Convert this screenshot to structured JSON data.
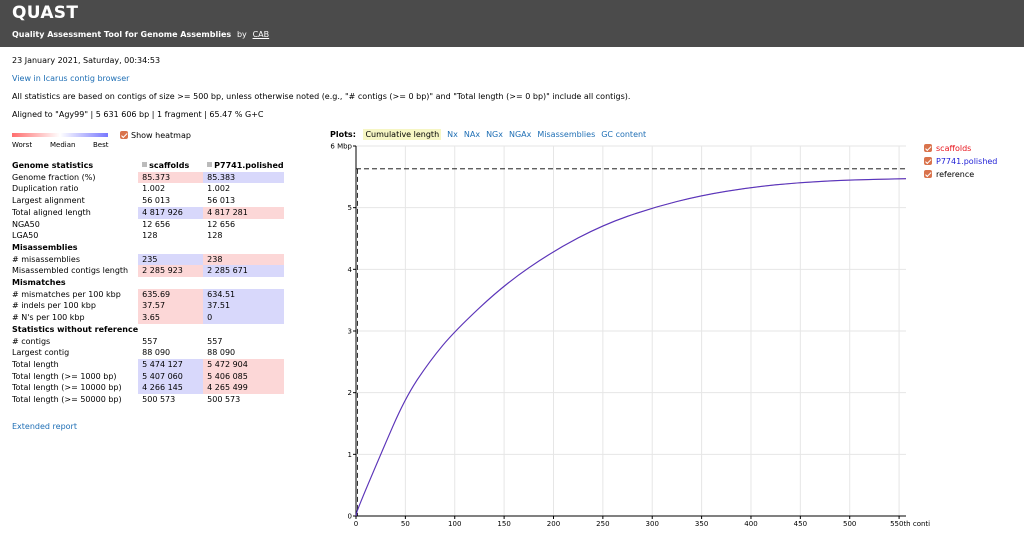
{
  "header": {
    "brand": "QUAST",
    "subtitle": "Quality Assessment Tool for Genome Assemblies",
    "by": "by",
    "by_link": "CAB"
  },
  "report": {
    "date": "23 January 2021, Saturday, 00:34:53",
    "icarus_link": "View in Icarus contig browser",
    "note": "All statistics are based on contigs of size >= 500 bp, unless otherwise noted (e.g., \"# contigs (>= 0 bp)\" and \"Total length (>= 0 bp)\" include all contigs).",
    "aligned": "Aligned to \"Agy99\" | 5 631 606 bp | 1 fragment | 65.47 % G+C"
  },
  "heatmap": {
    "worst": "Worst",
    "median": "Median",
    "best": "Best",
    "toggle_label": "Show heatmap",
    "colors": {
      "worst": "#ff6e6e",
      "median": "#ffffff",
      "best": "#7878ff"
    }
  },
  "stats": {
    "columns": [
      "scaffolds",
      "P7741.polished"
    ],
    "sections": [
      {
        "title": "Genome statistics",
        "header": true,
        "rows": [
          {
            "label": "Genome fraction (%)",
            "values": [
              "85.373",
              "85.383"
            ],
            "heat": [
              "red",
              "blue"
            ]
          },
          {
            "label": "Duplication ratio",
            "values": [
              "1.002",
              "1.002"
            ],
            "heat": [
              "",
              ""
            ]
          },
          {
            "label": "Largest alignment",
            "values": [
              "56 013",
              "56 013"
            ],
            "heat": [
              "",
              ""
            ]
          },
          {
            "label": "Total aligned length",
            "values": [
              "4 817 926",
              "4 817 281"
            ],
            "heat": [
              "blue",
              "red"
            ]
          },
          {
            "label": "NGA50",
            "values": [
              "12 656",
              "12 656"
            ],
            "heat": [
              "",
              ""
            ]
          },
          {
            "label": "LGA50",
            "values": [
              "128",
              "128"
            ],
            "heat": [
              "",
              ""
            ]
          }
        ]
      },
      {
        "title": "Misassemblies",
        "rows": [
          {
            "label": "# misassemblies",
            "values": [
              "235",
              "238"
            ],
            "heat": [
              "blue",
              "red"
            ]
          },
          {
            "label": "Misassembled contigs length",
            "values": [
              "2 285 923",
              "2 285 671"
            ],
            "heat": [
              "red",
              "blue"
            ]
          }
        ]
      },
      {
        "title": "Mismatches",
        "rows": [
          {
            "label": "# mismatches per 100 kbp",
            "values": [
              "635.69",
              "634.51"
            ],
            "heat": [
              "red",
              "blue"
            ]
          },
          {
            "label": "# indels per 100 kbp",
            "values": [
              "37.57",
              "37.51"
            ],
            "heat": [
              "red",
              "blue"
            ]
          },
          {
            "label": "# N's per 100 kbp",
            "values": [
              "3.65",
              "0"
            ],
            "heat": [
              "red",
              "blue"
            ]
          }
        ]
      },
      {
        "title": "Statistics without reference",
        "rows": [
          {
            "label": "# contigs",
            "values": [
              "557",
              "557"
            ],
            "heat": [
              "",
              ""
            ]
          },
          {
            "label": "Largest contig",
            "values": [
              "88 090",
              "88 090"
            ],
            "heat": [
              "",
              ""
            ]
          },
          {
            "label": "Total length",
            "values": [
              "5 474 127",
              "5 472 904"
            ],
            "heat": [
              "blue",
              "red"
            ]
          },
          {
            "label": "Total length (>= 1000 bp)",
            "values": [
              "5 407 060",
              "5 406 085"
            ],
            "heat": [
              "blue",
              "red"
            ]
          },
          {
            "label": "Total length (>= 10000 bp)",
            "values": [
              "4 266 145",
              "4 265 499"
            ],
            "heat": [
              "blue",
              "red"
            ]
          },
          {
            "label": "Total length (>= 50000 bp)",
            "values": [
              "500 573",
              "500 573"
            ],
            "heat": [
              "",
              ""
            ]
          }
        ]
      }
    ]
  },
  "extended_report": "Extended report",
  "plots": {
    "label": "Plots:",
    "tabs": [
      "Cumulative length",
      "Nx",
      "NAx",
      "NGx",
      "NGAx",
      "Misassemblies",
      "GC content"
    ],
    "selected": 0
  },
  "legend": [
    {
      "label": "scaffolds",
      "color": "#e8141c"
    },
    {
      "label": "P7741.polished",
      "color": "#1f1fd6"
    },
    {
      "label": "reference",
      "color": "#000000"
    }
  ],
  "chart_data": {
    "type": "line",
    "xlim": [
      0,
      557
    ],
    "ylim": [
      0,
      6
    ],
    "x_ticks": [
      "0",
      "50",
      "100",
      "150",
      "200",
      "250",
      "300",
      "350",
      "400",
      "450",
      "500",
      "550th contig"
    ],
    "y_ticks": [
      "0",
      "1",
      "2",
      "3",
      "4",
      "5",
      "6 Mbp"
    ],
    "grid": true,
    "series": [
      {
        "name": "scaffolds",
        "x": [
          1,
          25,
          50,
          75,
          100,
          150,
          200,
          250,
          300,
          350,
          400,
          450,
          500,
          557
        ],
        "y": [
          0.088,
          1.0,
          1.92,
          2.52,
          3.0,
          3.75,
          4.3,
          4.72,
          5.0,
          5.2,
          5.33,
          5.41,
          5.45,
          5.47
        ]
      },
      {
        "name": "P7741.polished",
        "x": [
          1,
          25,
          50,
          75,
          100,
          150,
          200,
          250,
          300,
          350,
          400,
          450,
          500,
          557
        ],
        "y": [
          0.088,
          1.0,
          1.92,
          2.52,
          3.0,
          3.75,
          4.3,
          4.72,
          5.0,
          5.2,
          5.33,
          5.41,
          5.45,
          5.47
        ]
      },
      {
        "name": "reference",
        "x": [
          0,
          557
        ],
        "y": [
          5.63,
          5.63
        ]
      }
    ]
  }
}
